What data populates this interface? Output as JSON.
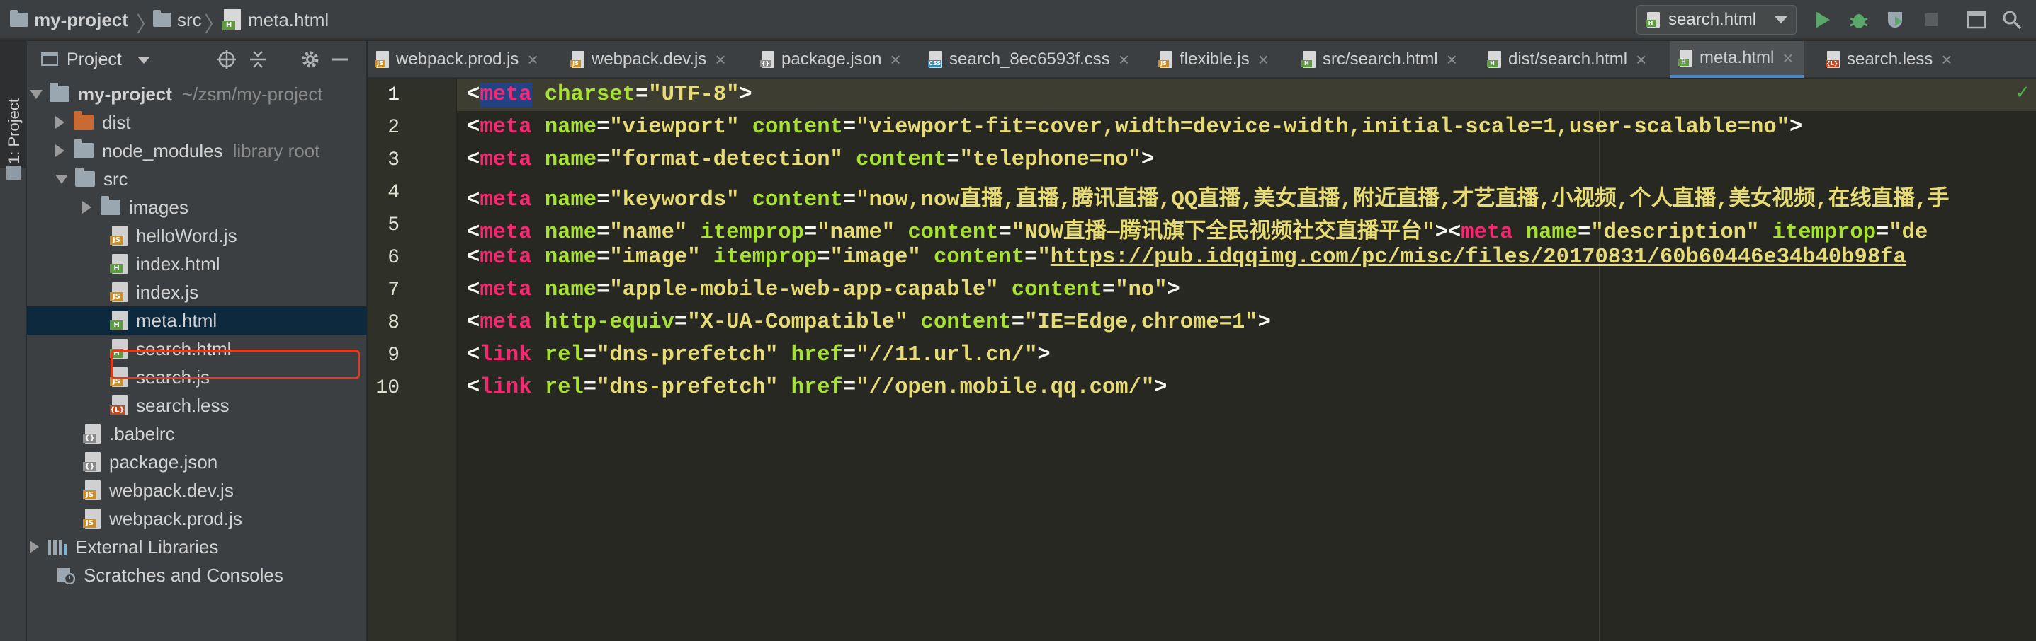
{
  "navbar": {
    "breadcrumbs": [
      {
        "label": "my-project",
        "icon": "folder-icon"
      },
      {
        "label": "src",
        "icon": "folder-icon"
      },
      {
        "label": "meta.html",
        "icon": "html-file-icon"
      }
    ],
    "run_config": "search.html"
  },
  "sidebar": {
    "strip_label": "1: Project",
    "title": "Project",
    "tree": [
      {
        "label": "my-project",
        "hint": "~/zsm/my-project",
        "type": "root"
      },
      {
        "label": "dist",
        "type": "folder-orange"
      },
      {
        "label": "node_modules",
        "hint": "library root",
        "type": "folder"
      },
      {
        "label": "src",
        "type": "folder-open"
      },
      {
        "label": "images",
        "type": "folder"
      },
      {
        "label": "helloWord.js",
        "type": "js"
      },
      {
        "label": "index.html",
        "type": "html"
      },
      {
        "label": "index.js",
        "type": "js"
      },
      {
        "label": "meta.html",
        "type": "html",
        "selected": true
      },
      {
        "label": "search.html",
        "type": "html"
      },
      {
        "label": "search.js",
        "type": "js"
      },
      {
        "label": "search.less",
        "type": "less"
      },
      {
        "label": ".babelrc",
        "type": "config"
      },
      {
        "label": "package.json",
        "type": "config"
      },
      {
        "label": "webpack.dev.js",
        "type": "js"
      },
      {
        "label": "webpack.prod.js",
        "type": "js"
      },
      {
        "label": "External Libraries",
        "type": "library"
      },
      {
        "label": "Scratches and Consoles",
        "type": "scratch"
      }
    ]
  },
  "tabs": [
    {
      "label": "webpack.prod.js",
      "tag": "JS"
    },
    {
      "label": "webpack.dev.js",
      "tag": "JS"
    },
    {
      "label": "package.json",
      "tag": "{}"
    },
    {
      "label": "search_8ec6593f.css",
      "tag": "CSS"
    },
    {
      "label": "flexible.js",
      "tag": "JS"
    },
    {
      "label": "src/search.html",
      "tag": "H"
    },
    {
      "label": "dist/search.html",
      "tag": "H"
    },
    {
      "label": "meta.html",
      "tag": "H",
      "active": true
    },
    {
      "label": "search.less",
      "tag": "L"
    }
  ],
  "editor": {
    "line_numbers": [
      "1",
      "2",
      "3",
      "4",
      "5",
      "6",
      "7",
      "8",
      "9",
      "10"
    ],
    "lines": [
      [
        [
          "p",
          "<"
        ],
        [
          "sel",
          "meta"
        ],
        [
          "p",
          " "
        ],
        [
          "a",
          "charset"
        ],
        [
          "p",
          "="
        ],
        [
          "s",
          "\"UTF-8\""
        ],
        [
          "p",
          ">"
        ]
      ],
      [
        [
          "p",
          "<"
        ],
        [
          "t",
          "meta"
        ],
        [
          "p",
          " "
        ],
        [
          "a",
          "name"
        ],
        [
          "p",
          "="
        ],
        [
          "s",
          "\"viewport\""
        ],
        [
          "p",
          " "
        ],
        [
          "a",
          "content"
        ],
        [
          "p",
          "="
        ],
        [
          "s",
          "\"viewport-fit=cover,width=device-width,initial-scale=1,user-scalable=no\""
        ],
        [
          "p",
          ">"
        ]
      ],
      [
        [
          "p",
          "<"
        ],
        [
          "t",
          "meta"
        ],
        [
          "p",
          " "
        ],
        [
          "a",
          "name"
        ],
        [
          "p",
          "="
        ],
        [
          "s",
          "\"format-detection\""
        ],
        [
          "p",
          " "
        ],
        [
          "a",
          "content"
        ],
        [
          "p",
          "="
        ],
        [
          "s",
          "\"telephone=no\""
        ],
        [
          "p",
          ">"
        ]
      ],
      [
        [
          "p",
          "<"
        ],
        [
          "t",
          "meta"
        ],
        [
          "p",
          " "
        ],
        [
          "a",
          "name"
        ],
        [
          "p",
          "="
        ],
        [
          "s",
          "\"keywords\""
        ],
        [
          "p",
          " "
        ],
        [
          "a",
          "content"
        ],
        [
          "p",
          "="
        ],
        [
          "s",
          "\"now,now直播,直播,腾讯直播,QQ直播,美女直播,附近直播,才艺直播,小视频,个人直播,美女视频,在线直播,手"
        ]
      ],
      [
        [
          "p",
          "<"
        ],
        [
          "t",
          "meta"
        ],
        [
          "p",
          " "
        ],
        [
          "a",
          "name"
        ],
        [
          "p",
          "="
        ],
        [
          "s",
          "\"name\""
        ],
        [
          "p",
          " "
        ],
        [
          "a",
          "itemprop"
        ],
        [
          "p",
          "="
        ],
        [
          "s",
          "\"name\""
        ],
        [
          "p",
          " "
        ],
        [
          "a",
          "content"
        ],
        [
          "p",
          "="
        ],
        [
          "s",
          "\"NOW直播—腾讯旗下全民视频社交直播平台\""
        ],
        [
          "p",
          "><"
        ],
        [
          "t",
          "meta"
        ],
        [
          "p",
          " "
        ],
        [
          "a",
          "name"
        ],
        [
          "p",
          "="
        ],
        [
          "s",
          "\"description\""
        ],
        [
          "p",
          " "
        ],
        [
          "a",
          "itemprop"
        ],
        [
          "p",
          "="
        ],
        [
          "s",
          "\"de"
        ]
      ],
      [
        [
          "p",
          "<"
        ],
        [
          "t",
          "meta"
        ],
        [
          "p",
          " "
        ],
        [
          "a",
          "name"
        ],
        [
          "p",
          "="
        ],
        [
          "s",
          "\"image\""
        ],
        [
          "p",
          " "
        ],
        [
          "a",
          "itemprop"
        ],
        [
          "p",
          "="
        ],
        [
          "s",
          "\"image\""
        ],
        [
          "p",
          " "
        ],
        [
          "a",
          "content"
        ],
        [
          "p",
          "="
        ],
        [
          "s",
          "\""
        ],
        [
          "u",
          "https://pub.idqqimg.com/pc/misc/files/20170831/60b60446e34b40b98fa"
        ]
      ],
      [
        [
          "p",
          "<"
        ],
        [
          "t",
          "meta"
        ],
        [
          "p",
          " "
        ],
        [
          "a",
          "name"
        ],
        [
          "p",
          "="
        ],
        [
          "s",
          "\"apple-mobile-web-app-capable\""
        ],
        [
          "p",
          " "
        ],
        [
          "a",
          "content"
        ],
        [
          "p",
          "="
        ],
        [
          "s",
          "\"no\""
        ],
        [
          "p",
          ">"
        ]
      ],
      [
        [
          "p",
          "<"
        ],
        [
          "t",
          "meta"
        ],
        [
          "p",
          " "
        ],
        [
          "a",
          "http-equiv"
        ],
        [
          "p",
          "="
        ],
        [
          "s",
          "\"X-UA-Compatible\""
        ],
        [
          "p",
          " "
        ],
        [
          "a",
          "content"
        ],
        [
          "p",
          "="
        ],
        [
          "s",
          "\"IE=Edge,chrome=1\""
        ],
        [
          "p",
          ">"
        ]
      ],
      [
        [
          "p",
          "<"
        ],
        [
          "t",
          "link"
        ],
        [
          "p",
          " "
        ],
        [
          "a",
          "rel"
        ],
        [
          "p",
          "="
        ],
        [
          "s",
          "\"dns-prefetch\""
        ],
        [
          "p",
          " "
        ],
        [
          "a",
          "href"
        ],
        [
          "p",
          "="
        ],
        [
          "s",
          "\"//11.url.cn/\""
        ],
        [
          "p",
          ">"
        ]
      ],
      [
        [
          "p",
          "<"
        ],
        [
          "t",
          "link"
        ],
        [
          "p",
          " "
        ],
        [
          "a",
          "rel"
        ],
        [
          "p",
          "="
        ],
        [
          "s",
          "\"dns-prefetch\""
        ],
        [
          "p",
          " "
        ],
        [
          "a",
          "href"
        ],
        [
          "p",
          "="
        ],
        [
          "s",
          "\"//open.mobile.qq.com/\""
        ],
        [
          "p",
          ">"
        ]
      ]
    ]
  },
  "colors": {
    "accent": "#4a88c7",
    "highlight_box": "#e8391d",
    "tag": "#f92672",
    "attr": "#a6e22e",
    "string": "#e6db74"
  }
}
